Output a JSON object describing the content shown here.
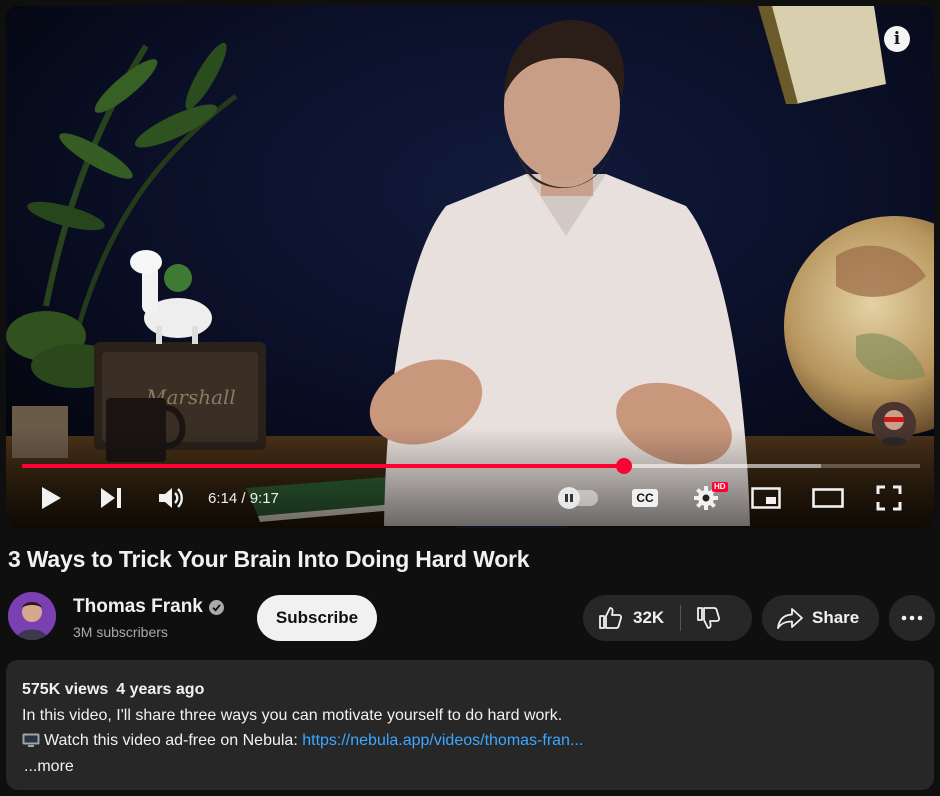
{
  "player": {
    "info_icon": "info-icon",
    "current_time": "6:14",
    "duration": "9:17",
    "time_display": "6:14 / 9:17",
    "progress_played_pct": 67,
    "progress_buffered_pct": 89,
    "autoplay_on": false,
    "captions_label": "CC",
    "quality_badge": "HD",
    "icons": {
      "play": "play-icon",
      "next": "next-icon",
      "volume": "volume-icon",
      "autoplay": "autoplay-toggle",
      "captions": "captions-icon",
      "settings": "gear-icon",
      "miniplayer": "miniplayer-icon",
      "theater": "theater-icon",
      "fullscreen": "fullscreen-icon"
    },
    "accent_color": "#ff0033"
  },
  "video": {
    "title": "3 Ways to Trick Your Brain Into Doing Hard Work"
  },
  "channel": {
    "name": "Thomas Frank",
    "subscribers": "3M subscribers",
    "verified": true,
    "subscribe_label": "Subscribe"
  },
  "actions": {
    "like_count": "32K",
    "share_label": "Share",
    "icons": {
      "like": "thumbs-up-icon",
      "dislike": "thumbs-down-icon",
      "share": "share-icon",
      "more": "more-horizontal-icon"
    }
  },
  "description": {
    "views": "575K views",
    "age": "4 years ago",
    "line1": "In this video, I'll share three ways you can motivate yourself to do hard work.",
    "line2_prefix": "Watch this video ad-free on Nebula: ",
    "line2_link": "https://nebula.app/videos/thomas-fran...",
    "more_label": "...more",
    "link_color": "#3ea6ff"
  }
}
